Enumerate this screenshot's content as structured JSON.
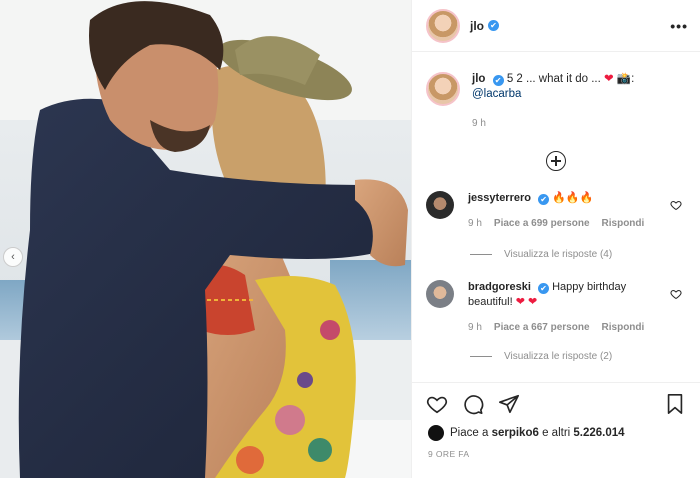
{
  "post": {
    "username": "jlo",
    "verified_glyph": "✔",
    "more_glyph": "•••"
  },
  "caption": {
    "username": "jlo",
    "text": "5 2 ... what it do ...",
    "heart": "❤",
    "camera": "📸",
    "mention": "@lacarba",
    "time": "9 h"
  },
  "comments": [
    {
      "username": "jessyterrero",
      "text": "🔥🔥🔥",
      "time": "9 h",
      "likes": "Piace a 699 persone",
      "reply": "Rispondi",
      "view_replies": "Visualizza le risposte (4)"
    },
    {
      "username": "bradgoreski",
      "text": "Happy birthday beautiful!",
      "hearts": "❤ ❤",
      "time": "9 h",
      "likes": "Piace a 667 persone",
      "reply": "Rispondi",
      "view_replies": "Visualizza le risposte (2)"
    }
  ],
  "footer": {
    "likes_prefix": "Piace a",
    "likes_user": "serpiko6",
    "likes_mid": "e altri",
    "likes_count": "5.226.014",
    "time_ago": "9 ORE FA"
  },
  "icons": [
    "heart-icon",
    "comment-icon",
    "share-icon",
    "save-icon",
    "chevron-left-icon",
    "add-circle-icon",
    "more-icon"
  ],
  "colors": {
    "verified": "#3897f0",
    "link": "#00376b",
    "muted": "#8e8e8e",
    "heart": "#ed1c40"
  }
}
